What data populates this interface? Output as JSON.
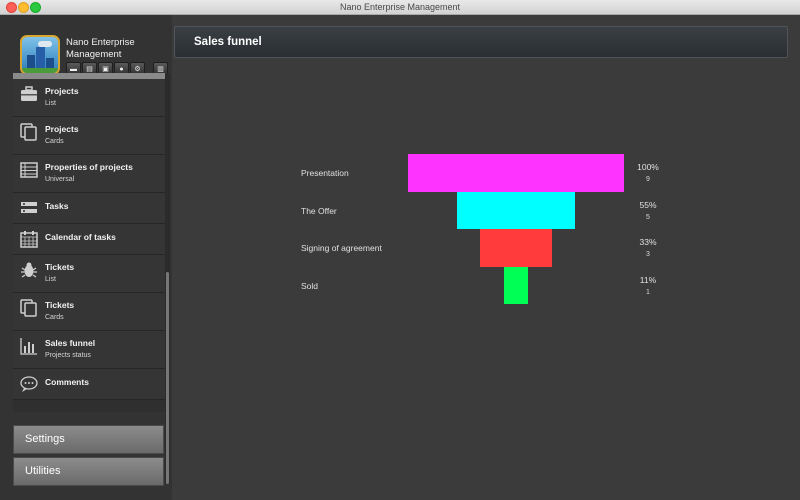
{
  "window": {
    "title": "Nano Enterprise Management"
  },
  "app": {
    "name": "Nano Enterprise Management",
    "tools": [
      "folder-icon",
      "printer-icon",
      "briefcase-icon",
      "user-icon",
      "users-gear-icon",
      "trash-icon"
    ]
  },
  "sidebar": {
    "items": [
      {
        "label": "Projects",
        "sub": "List",
        "icon": "briefcase-icon"
      },
      {
        "label": "Projects",
        "sub": "Cards",
        "icon": "cards-icon"
      },
      {
        "label": "Properties of projects",
        "sub": "Universal",
        "icon": "table-icon"
      },
      {
        "label": "Tasks",
        "sub": "",
        "icon": "tasks-icon"
      },
      {
        "label": "Calendar of tasks",
        "sub": "",
        "icon": "calendar-icon"
      },
      {
        "label": "Tickets",
        "sub": "List",
        "icon": "bug-icon"
      },
      {
        "label": "Tickets",
        "sub": "Cards",
        "icon": "cards-icon"
      },
      {
        "label": "Sales funnel",
        "sub": "Projects status",
        "icon": "bar-chart-icon"
      },
      {
        "label": "Comments",
        "sub": "",
        "icon": "speech-bubble-icon"
      }
    ],
    "sections": [
      "Settings",
      "Utilities"
    ]
  },
  "main": {
    "title": "Sales funnel"
  },
  "chart_data": {
    "type": "funnel",
    "stages": [
      {
        "label": "Presentation",
        "percent": "100%",
        "count": "9",
        "value": 100,
        "color": "#ff33ff"
      },
      {
        "label": "The Offer",
        "percent": "55%",
        "count": "5",
        "value": 55,
        "color": "#00ffff"
      },
      {
        "label": "Signing of agreement",
        "percent": "33%",
        "count": "3",
        "value": 33,
        "color": "#ff3b3b"
      },
      {
        "label": "Sold",
        "percent": "11%",
        "count": "1",
        "value": 11,
        "color": "#00ff55"
      }
    ]
  }
}
